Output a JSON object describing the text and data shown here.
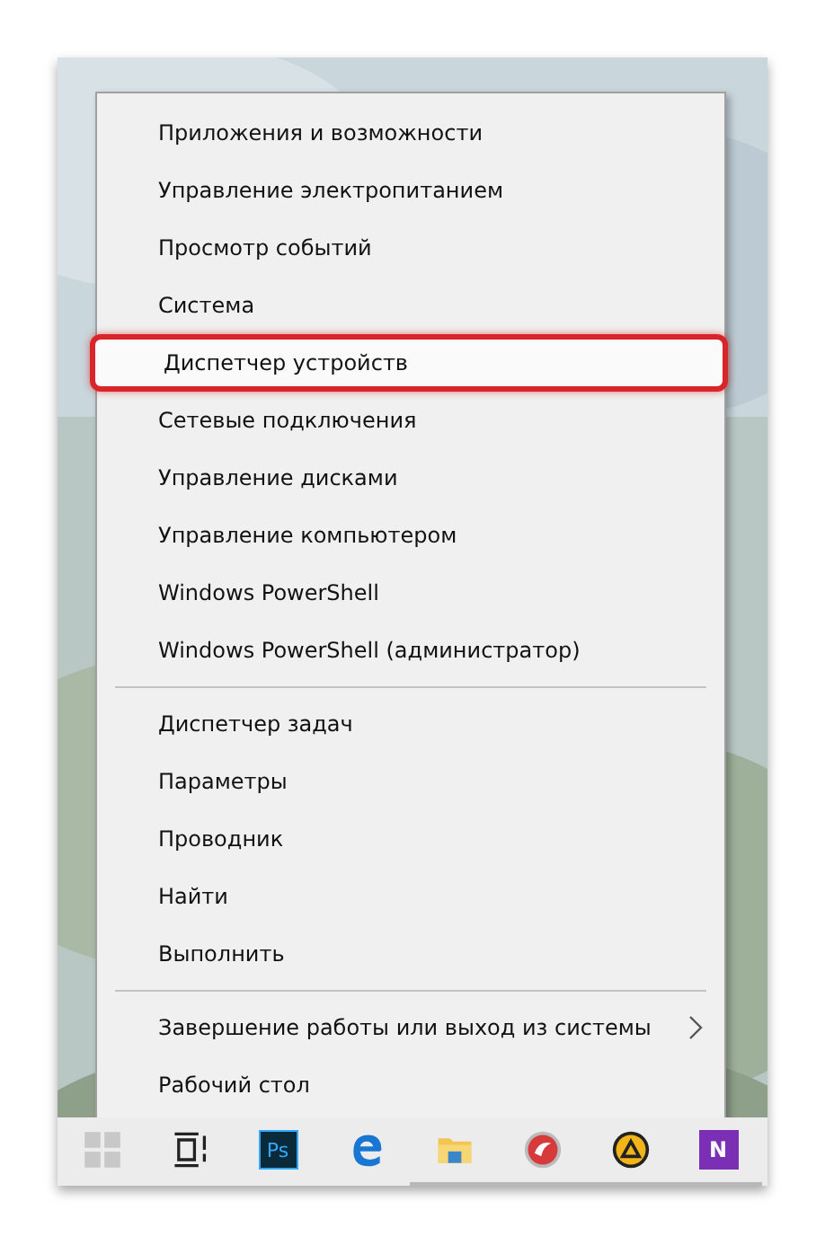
{
  "menu": {
    "sections": [
      {
        "items": [
          {
            "label": "Приложения и возможности",
            "highlighted": false,
            "has_submenu": false
          },
          {
            "label": "Управление электропитанием",
            "highlighted": false,
            "has_submenu": false
          },
          {
            "label": "Просмотр событий",
            "highlighted": false,
            "has_submenu": false
          },
          {
            "label": "Система",
            "highlighted": false,
            "has_submenu": false
          },
          {
            "label": "Диспетчер устройств",
            "highlighted": true,
            "has_submenu": false
          },
          {
            "label": "Сетевые подключения",
            "highlighted": false,
            "has_submenu": false
          },
          {
            "label": "Управление дисками",
            "highlighted": false,
            "has_submenu": false
          },
          {
            "label": "Управление компьютером",
            "highlighted": false,
            "has_submenu": false
          },
          {
            "label": "Windows PowerShell",
            "highlighted": false,
            "has_submenu": false
          },
          {
            "label": "Windows PowerShell (администратор)",
            "highlighted": false,
            "has_submenu": false
          }
        ]
      },
      {
        "items": [
          {
            "label": "Диспетчер задач",
            "highlighted": false,
            "has_submenu": false
          },
          {
            "label": "Параметры",
            "highlighted": false,
            "has_submenu": false
          },
          {
            "label": "Проводник",
            "highlighted": false,
            "has_submenu": false
          },
          {
            "label": "Найти",
            "highlighted": false,
            "has_submenu": false
          },
          {
            "label": "Выполнить",
            "highlighted": false,
            "has_submenu": false
          }
        ]
      },
      {
        "items": [
          {
            "label": "Завершение работы или выход из системы",
            "highlighted": false,
            "has_submenu": true
          },
          {
            "label": "Рабочий стол",
            "highlighted": false,
            "has_submenu": false
          }
        ]
      }
    ]
  },
  "taskbar": {
    "apps": [
      {
        "kind": "start",
        "running": false
      },
      {
        "kind": "taskview",
        "running": false
      },
      {
        "kind": "ps",
        "label": "Ps",
        "running": false
      },
      {
        "kind": "edge",
        "running": false
      },
      {
        "kind": "folder",
        "running": true
      },
      {
        "kind": "swirl",
        "running": true
      },
      {
        "kind": "triangle",
        "running": true
      },
      {
        "kind": "onenote",
        "label": "N",
        "running": true
      }
    ]
  }
}
